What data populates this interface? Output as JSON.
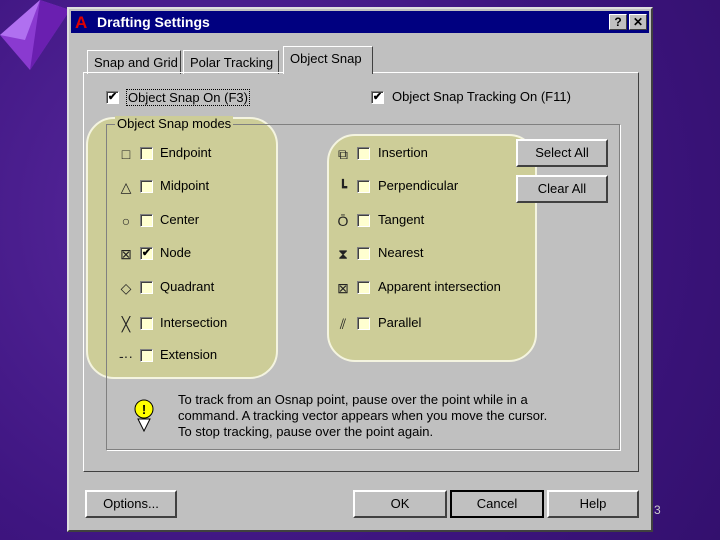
{
  "window": {
    "title": "Drafting Settings",
    "help_button": "?",
    "close_button": "✕"
  },
  "tabs": [
    {
      "label": "Snap and Grid"
    },
    {
      "label": "Polar Tracking"
    },
    {
      "label": "Object Snap",
      "active": true
    }
  ],
  "toggles": {
    "osnap_on": {
      "label": "Object Snap On (F3)",
      "checked": true
    },
    "tracking_on": {
      "label": "Object Snap Tracking On (F11)",
      "checked": true
    }
  },
  "group_title": "Object Snap modes",
  "modes_left": [
    {
      "label": "Endpoint",
      "symbol": "□",
      "checked": false
    },
    {
      "label": "Midpoint",
      "symbol": "△",
      "checked": false
    },
    {
      "label": "Center",
      "symbol": "○",
      "checked": false
    },
    {
      "label": "Node",
      "symbol": "⊠",
      "checked": true
    },
    {
      "label": "Quadrant",
      "symbol": "◇",
      "checked": false
    },
    {
      "label": "Intersection",
      "symbol": "╳",
      "checked": false
    },
    {
      "label": "Extension",
      "symbol": "-··",
      "checked": false
    }
  ],
  "modes_right": [
    {
      "label": "Insertion",
      "symbol": "⧉",
      "checked": false
    },
    {
      "label": "Perpendicular",
      "symbol": "┗",
      "checked": false
    },
    {
      "label": "Tangent",
      "symbol": "Ō",
      "checked": false
    },
    {
      "label": "Nearest",
      "symbol": "⧗",
      "checked": false
    },
    {
      "label": "Apparent intersection",
      "symbol": "⊠",
      "checked": false
    },
    {
      "label": "Parallel",
      "symbol": "⫽",
      "checked": false
    }
  ],
  "buttons": {
    "select_all": "Select All",
    "clear_all": "Clear All",
    "options": "Options...",
    "ok": "OK",
    "cancel": "Cancel",
    "help": "Help"
  },
  "tip_lines": [
    "To track from an Osnap point, pause over the point while in a",
    "command.  A tracking vector appears when you move the cursor.",
    "To stop tracking, pause over the point again."
  ],
  "slide_number": "3",
  "colors": {
    "titlebar": "#000080",
    "dialog": "#c0c0c0",
    "highlight": "#cdcd98",
    "background": "#3e1580"
  }
}
